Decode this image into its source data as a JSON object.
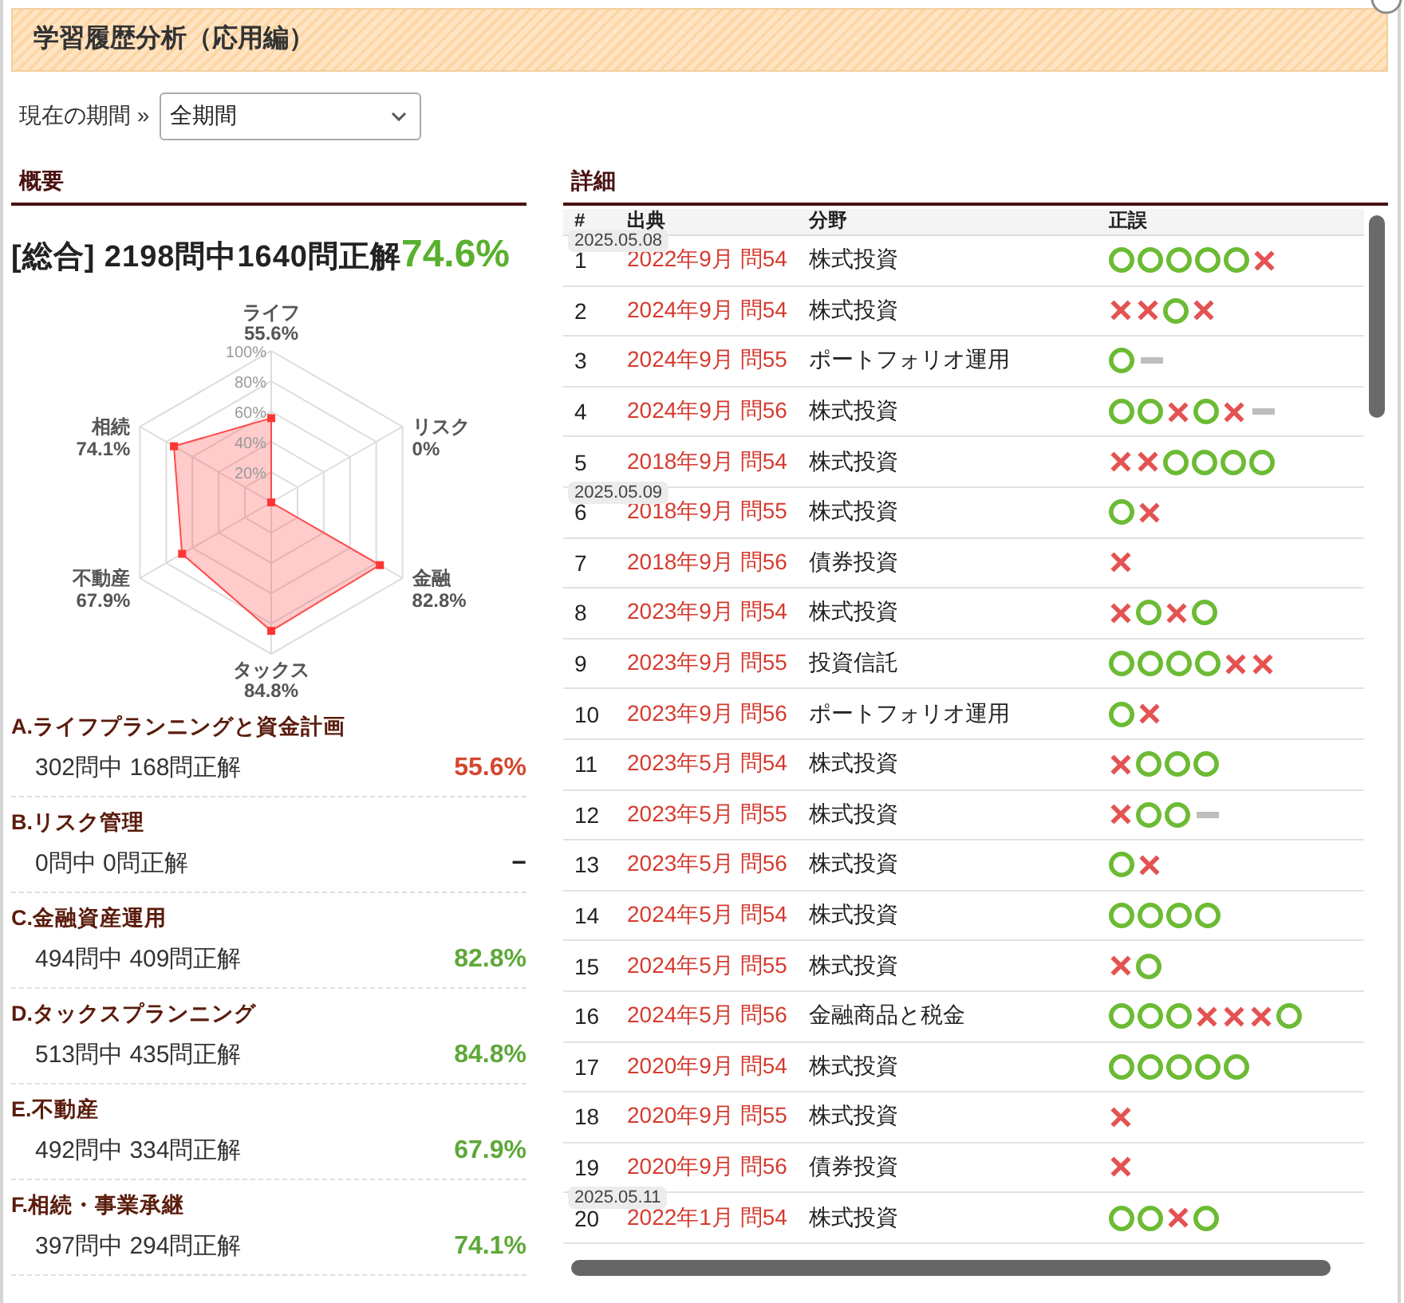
{
  "title": "学習履歴分析（応用編）",
  "period": {
    "label": "現在の期間 »",
    "value": "全期間"
  },
  "overview": {
    "heading": "概要",
    "summary": {
      "label": "[総合] 2198問中1640問正解",
      "rate": "74.6%"
    },
    "radar": {
      "ticks": [
        "100%",
        "80%",
        "60%",
        "40%",
        "20%"
      ],
      "axes": [
        {
          "label": "ライフ",
          "reading": "55.6%"
        },
        {
          "label": "相続",
          "reading": "74.1%"
        },
        {
          "label": "リスク",
          "reading": "0%"
        },
        {
          "label": "不動産",
          "reading": "67.9%"
        },
        {
          "label": "金融",
          "reading": "82.8%"
        },
        {
          "label": "タックス",
          "reading": "84.8%"
        }
      ]
    },
    "categories": [
      {
        "name": "A.ライフプランニングと資金計画",
        "count": "302問中 168問正解",
        "rate": "55.6%",
        "color": "#d4472e"
      },
      {
        "name": "B.リスク管理",
        "count": "0問中 0問正解",
        "rate": "−",
        "color": "#222222"
      },
      {
        "name": "C.金融資産運用",
        "count": "494問中 409問正解",
        "rate": "82.8%",
        "color": "#5ea83a"
      },
      {
        "name": "D.タックスプランニング",
        "count": "513問中 435問正解",
        "rate": "84.8%",
        "color": "#5ea83a"
      },
      {
        "name": "E.不動産",
        "count": "492問中 334問正解",
        "rate": "67.9%",
        "color": "#5ea83a"
      },
      {
        "name": "F.相続・事業承継",
        "count": "397問中 294問正解",
        "rate": "74.1%",
        "color": "#5ea83a"
      }
    ]
  },
  "detail": {
    "heading": "詳細",
    "columns": [
      "#",
      "出典",
      "分野",
      "正誤"
    ],
    "groups": [
      {
        "date": "2025.05.08",
        "rows": [
          {
            "no": "1",
            "source": "2022年9月 問54",
            "field": "株式投資",
            "marks": [
              {
                "kind": "correct"
              },
              {
                "kind": "correct"
              },
              {
                "kind": "correct"
              },
              {
                "kind": "correct"
              },
              {
                "kind": "correct"
              },
              {
                "kind": "wrong"
              }
            ]
          },
          {
            "no": "2",
            "source": "2024年9月 問54",
            "field": "株式投資",
            "marks": [
              {
                "kind": "wrong"
              },
              {
                "kind": "wrong"
              },
              {
                "kind": "correct"
              },
              {
                "kind": "wrong"
              }
            ]
          },
          {
            "no": "3",
            "source": "2024年9月 問55",
            "field": "ポートフォリオ運用",
            "marks": [
              {
                "kind": "correct"
              },
              {
                "kind": "blank"
              }
            ]
          },
          {
            "no": "4",
            "source": "2024年9月 問56",
            "field": "株式投資",
            "marks": [
              {
                "kind": "correct"
              },
              {
                "kind": "correct"
              },
              {
                "kind": "wrong"
              },
              {
                "kind": "correct"
              },
              {
                "kind": "wrong"
              },
              {
                "kind": "blank"
              }
            ]
          },
          {
            "no": "5",
            "source": "2018年9月 問54",
            "field": "株式投資",
            "marks": [
              {
                "kind": "wrong"
              },
              {
                "kind": "wrong"
              },
              {
                "kind": "correct"
              },
              {
                "kind": "correct"
              },
              {
                "kind": "correct"
              },
              {
                "kind": "correct"
              }
            ]
          }
        ]
      },
      {
        "date": "2025.05.09",
        "rows": [
          {
            "no": "6",
            "source": "2018年9月 問55",
            "field": "株式投資",
            "marks": [
              {
                "kind": "correct"
              },
              {
                "kind": "wrong"
              }
            ]
          },
          {
            "no": "7",
            "source": "2018年9月 問56",
            "field": "債券投資",
            "marks": [
              {
                "kind": "wrong"
              }
            ]
          },
          {
            "no": "8",
            "source": "2023年9月 問54",
            "field": "株式投資",
            "marks": [
              {
                "kind": "wrong"
              },
              {
                "kind": "correct"
              },
              {
                "kind": "wrong"
              },
              {
                "kind": "correct"
              }
            ]
          },
          {
            "no": "9",
            "source": "2023年9月 問55",
            "field": "投資信託",
            "marks": [
              {
                "kind": "correct"
              },
              {
                "kind": "correct"
              },
              {
                "kind": "correct"
              },
              {
                "kind": "correct"
              },
              {
                "kind": "wrong"
              },
              {
                "kind": "wrong"
              }
            ]
          },
          {
            "no": "10",
            "source": "2023年9月 問56",
            "field": "ポートフォリオ運用",
            "marks": [
              {
                "kind": "correct"
              },
              {
                "kind": "wrong"
              }
            ]
          },
          {
            "no": "11",
            "source": "2023年5月 問54",
            "field": "株式投資",
            "marks": [
              {
                "kind": "wrong"
              },
              {
                "kind": "correct"
              },
              {
                "kind": "correct"
              },
              {
                "kind": "correct"
              }
            ]
          },
          {
            "no": "12",
            "source": "2023年5月 問55",
            "field": "株式投資",
            "marks": [
              {
                "kind": "wrong"
              },
              {
                "kind": "correct"
              },
              {
                "kind": "correct"
              },
              {
                "kind": "blank"
              }
            ]
          },
          {
            "no": "13",
            "source": "2023年5月 問56",
            "field": "株式投資",
            "marks": [
              {
                "kind": "correct"
              },
              {
                "kind": "wrong"
              }
            ]
          },
          {
            "no": "14",
            "source": "2024年5月 問54",
            "field": "株式投資",
            "marks": [
              {
                "kind": "correct"
              },
              {
                "kind": "correct"
              },
              {
                "kind": "correct"
              },
              {
                "kind": "correct"
              }
            ]
          },
          {
            "no": "15",
            "source": "2024年5月 問55",
            "field": "株式投資",
            "marks": [
              {
                "kind": "wrong"
              },
              {
                "kind": "correct"
              }
            ]
          },
          {
            "no": "16",
            "source": "2024年5月 問56",
            "field": "金融商品と税金",
            "marks": [
              {
                "kind": "correct"
              },
              {
                "kind": "correct"
              },
              {
                "kind": "correct"
              },
              {
                "kind": "wrong"
              },
              {
                "kind": "wrong"
              },
              {
                "kind": "wrong"
              },
              {
                "kind": "correct"
              }
            ]
          },
          {
            "no": "17",
            "source": "2020年9月 問54",
            "field": "株式投資",
            "marks": [
              {
                "kind": "correct"
              },
              {
                "kind": "correct"
              },
              {
                "kind": "correct"
              },
              {
                "kind": "correct"
              },
              {
                "kind": "correct"
              }
            ]
          },
          {
            "no": "18",
            "source": "2020年9月 問55",
            "field": "株式投資",
            "marks": [
              {
                "kind": "wrong"
              }
            ]
          },
          {
            "no": "19",
            "source": "2020年9月 問56",
            "field": "債券投資",
            "marks": [
              {
                "kind": "wrong"
              }
            ]
          }
        ]
      },
      {
        "date": "2025.05.11",
        "rows": [
          {
            "no": "20",
            "source": "2022年1月 問54",
            "field": "株式投資",
            "marks": [
              {
                "kind": "correct"
              },
              {
                "kind": "correct"
              },
              {
                "kind": "wrong"
              },
              {
                "kind": "correct"
              }
            ]
          }
        ]
      }
    ]
  }
}
